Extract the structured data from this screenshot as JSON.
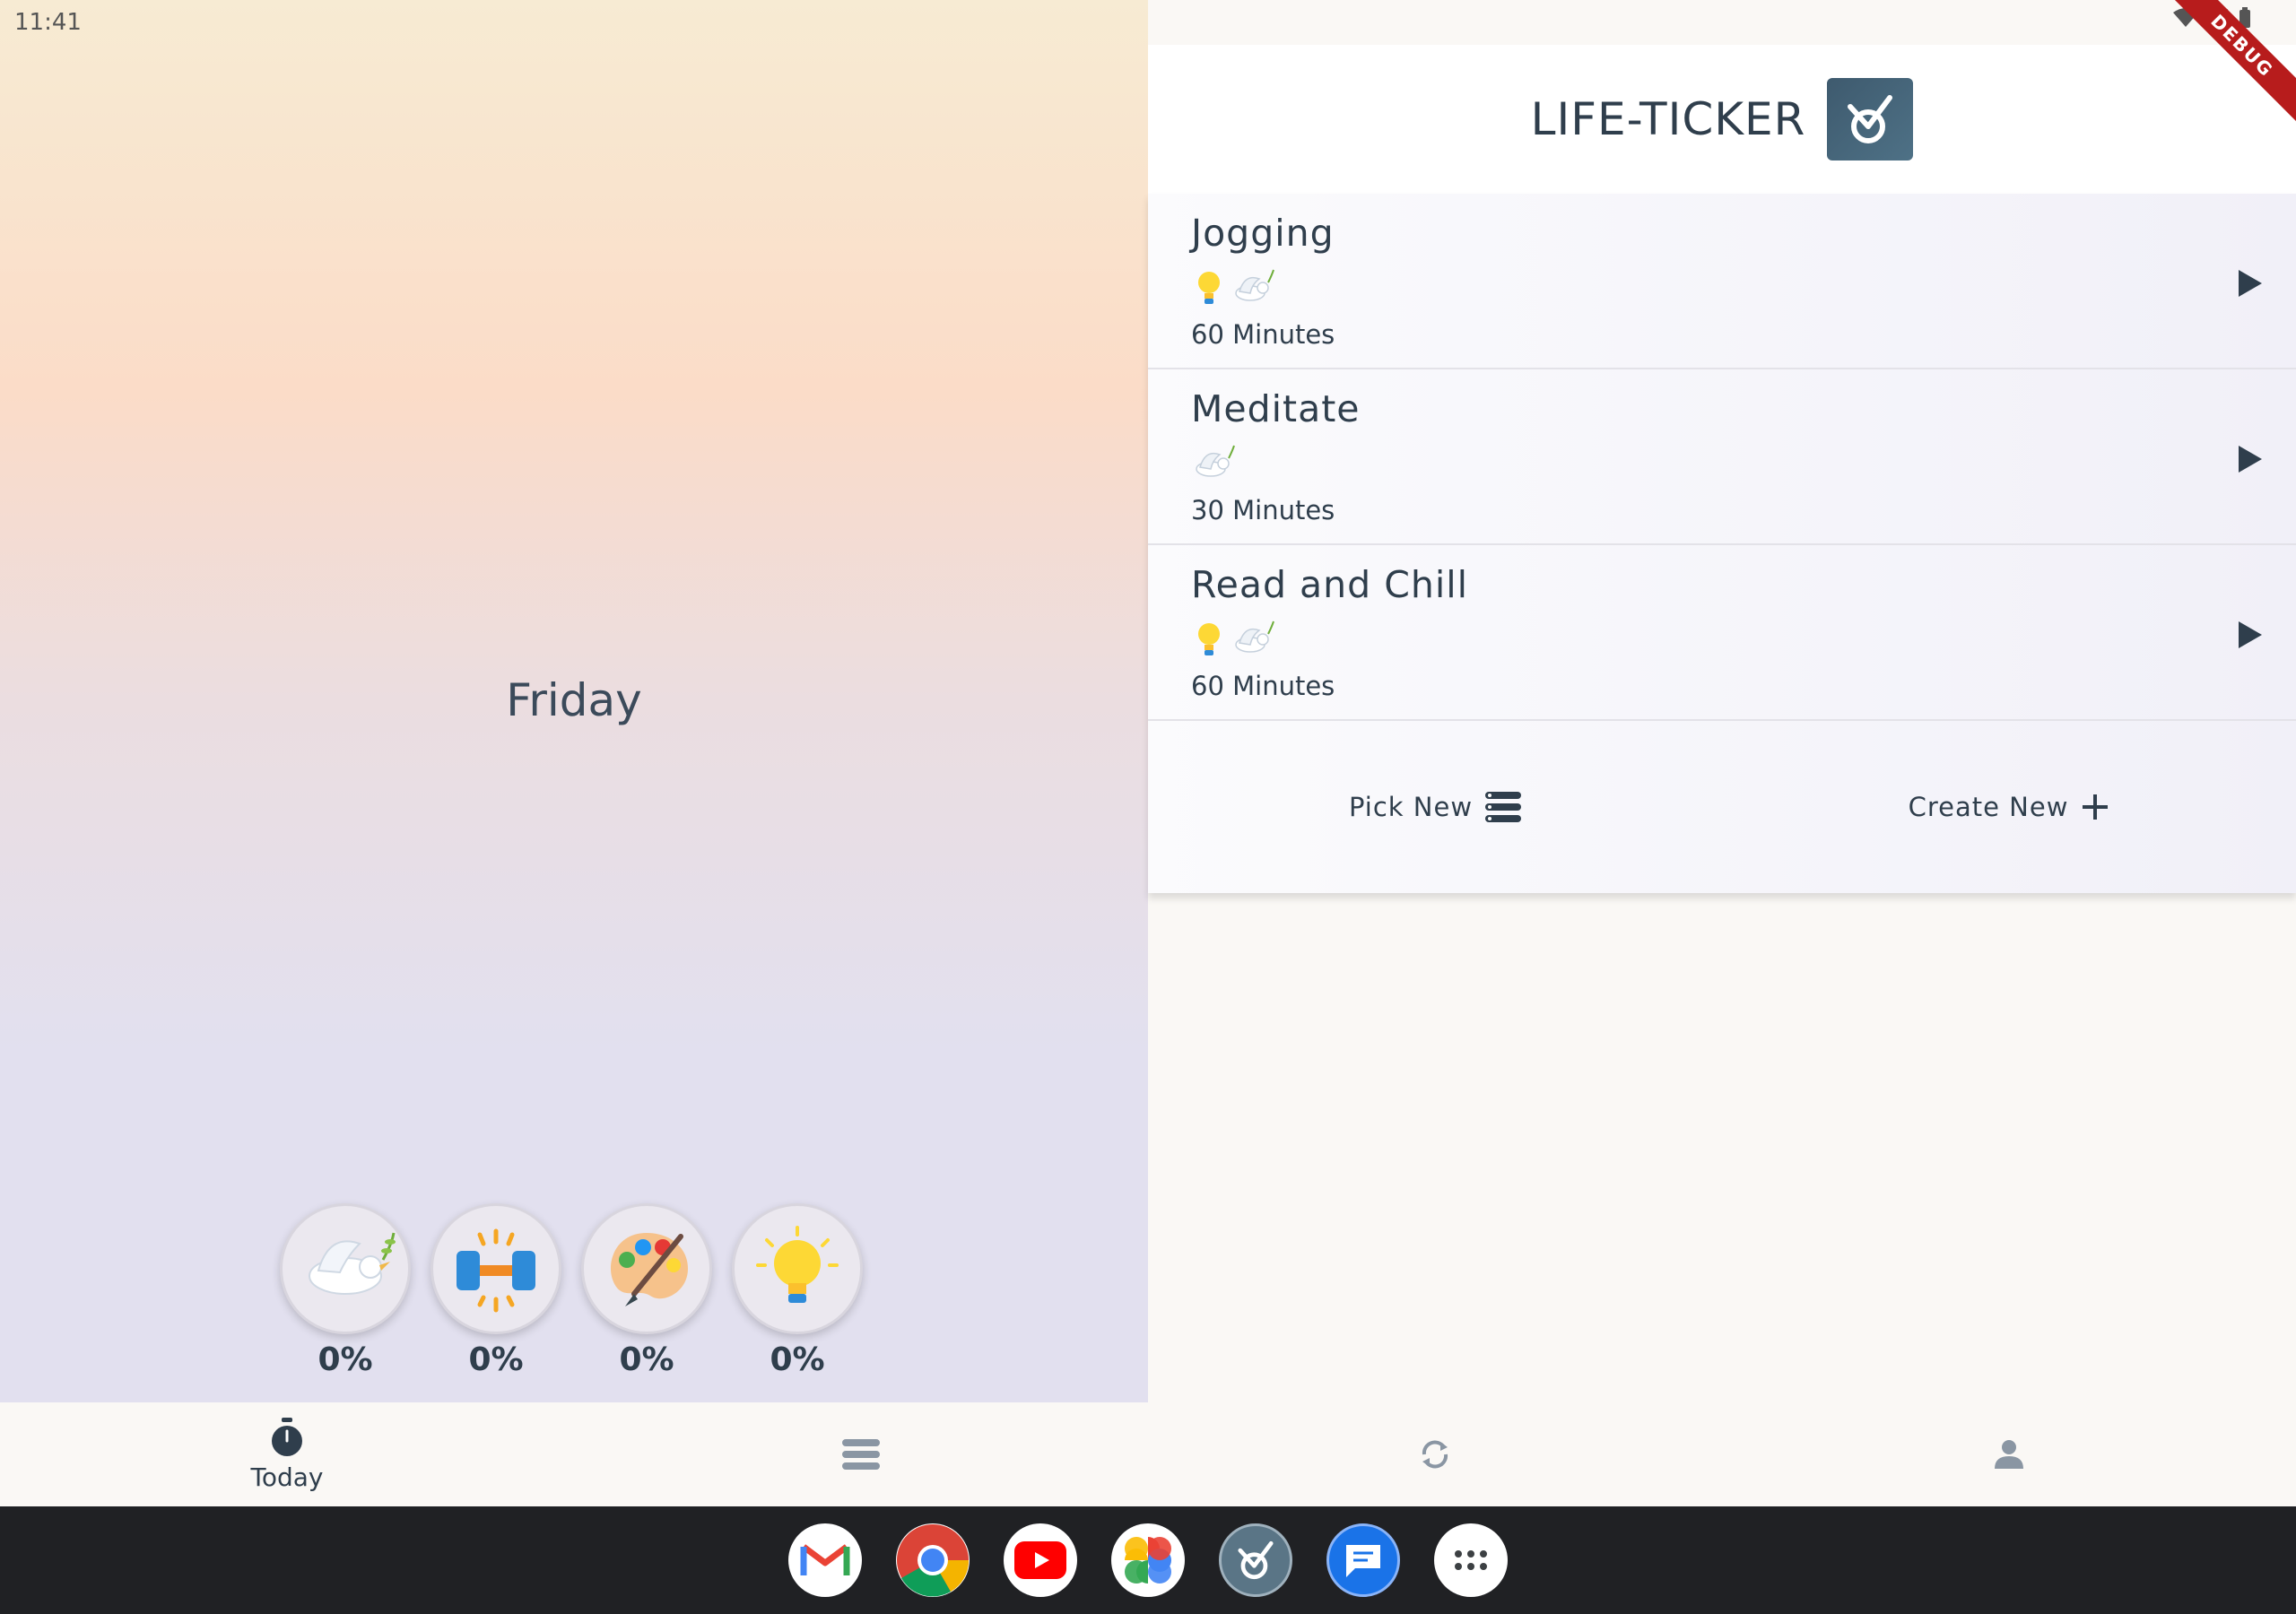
{
  "status_bar": {
    "time": "11:41"
  },
  "debug_banner": "DEBUG",
  "left": {
    "day": "Friday",
    "stats": [
      {
        "icon": "dove-icon",
        "value": "0%"
      },
      {
        "icon": "dumbbell-icon",
        "value": "0%"
      },
      {
        "icon": "palette-icon",
        "value": "0%"
      },
      {
        "icon": "lightbulb-icon",
        "value": "0%"
      }
    ]
  },
  "header": {
    "title": "LIFE-TICKER",
    "logo_icon": "life-ticker-logo-icon"
  },
  "tasks": [
    {
      "name": "Jogging",
      "icons": [
        "lightbulb-icon",
        "dove-icon"
      ],
      "duration": "60 Minutes"
    },
    {
      "name": "Meditate",
      "icons": [
        "dove-icon"
      ],
      "duration": "30 Minutes"
    },
    {
      "name": "Read and Chill",
      "icons": [
        "lightbulb-icon",
        "dove-icon"
      ],
      "duration": "60 Minutes"
    }
  ],
  "actions": {
    "pick_new": "Pick New",
    "create_new": "Create New"
  },
  "nav": {
    "today": "Today"
  },
  "dock": [
    "gmail-icon",
    "chrome-icon",
    "youtube-icon",
    "photos-icon",
    "life-ticker-icon",
    "messages-icon",
    "app-drawer-icon"
  ],
  "colors": {
    "primary": "#2f3e4c",
    "logo": "#3e5a6e",
    "debug": "#b71c1c"
  }
}
